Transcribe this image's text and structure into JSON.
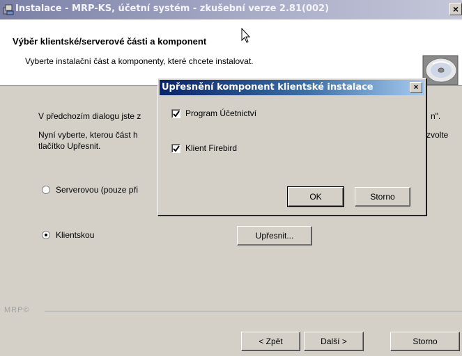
{
  "window": {
    "title": "Instalace - MRP-KS, účetní systém - zkušební verze 2.81(002)",
    "close_glyph": "×"
  },
  "header": {
    "title": "Výběr klientské/serverové části a komponent",
    "subtitle": "Vyberte instalační část a komponenty, které chcete instalovat.",
    "icon": "cd-icon"
  },
  "body": {
    "line1_left": "V předchozím dialogu jste z",
    "line1_right": "n\".",
    "line2a_left": "Nyní vyberte, kterou část h",
    "line2b_left": "tlačítko Upřesnit.",
    "line2_right": "zvolte"
  },
  "options": [
    {
      "label": "Serverovou (pouze při",
      "selected": false
    },
    {
      "label": "Klientskou",
      "selected": true
    }
  ],
  "buttons": {
    "upresnit": "Upřesnit...",
    "back": "< Zpět",
    "next": "Další >",
    "cancel": "Storno"
  },
  "brand": "MRP©",
  "dialog": {
    "title": "Upřesnění komponent klientské instalace",
    "close_glyph": "×",
    "items": [
      {
        "label": "Program Účetnictví",
        "checked": true
      },
      {
        "label": "Klient Firebird",
        "checked": true
      }
    ],
    "ok": "OK",
    "cancel": "Storno"
  }
}
